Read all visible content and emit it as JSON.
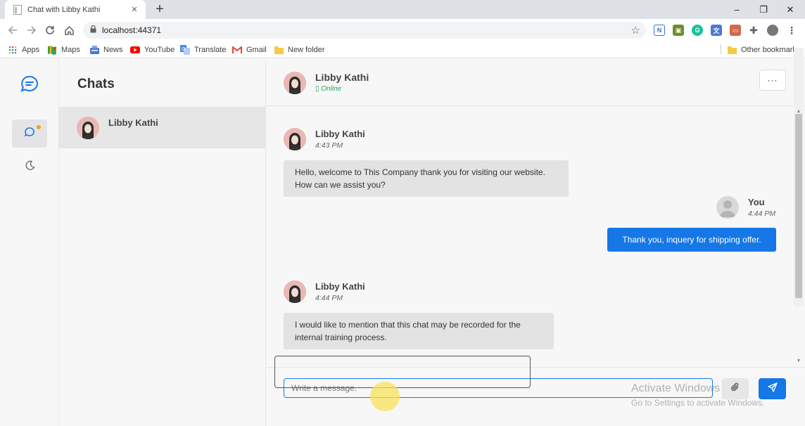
{
  "browser": {
    "tab_title": "Chat with Libby Kathi",
    "tab_close": "×",
    "new_tab": "+",
    "url": "localhost:44371",
    "window_controls": {
      "minimize": "–",
      "restore": "❐",
      "close": "✕"
    },
    "bookmarks": [
      "Apps",
      "Maps",
      "News",
      "YouTube",
      "Translate",
      "Gmail",
      "New folder"
    ],
    "other_bookmarks": "Other bookmarks"
  },
  "sidebar": {
    "title": "Chats",
    "chats": [
      {
        "name": "Libby Kathi"
      }
    ]
  },
  "conversation": {
    "contact_name": "Libby Kathi",
    "status": "▯ Online",
    "more_label": "···",
    "messages": [
      {
        "sender": "Libby Kathi",
        "time": "4:43 PM",
        "text": "Hello, welcome to This Company thank you for visiting our website. How can we assist you?"
      },
      {
        "sender": "You",
        "time": "4:44 PM",
        "text": "Thank you, inquery for shipping offer."
      },
      {
        "sender": "Libby Kathi",
        "time": "4:44 PM",
        "text": "I would like to mention that this chat may be recorded for the internal training process."
      }
    ],
    "composer": {
      "placeholder": "Write a message."
    }
  },
  "watermark": {
    "line1": "Activate Windows",
    "line2": "Go to Settings to activate Windows."
  },
  "colors": {
    "accent": "#1677e6",
    "online": "#26a65b",
    "notification_dot": "#f6a30a"
  }
}
